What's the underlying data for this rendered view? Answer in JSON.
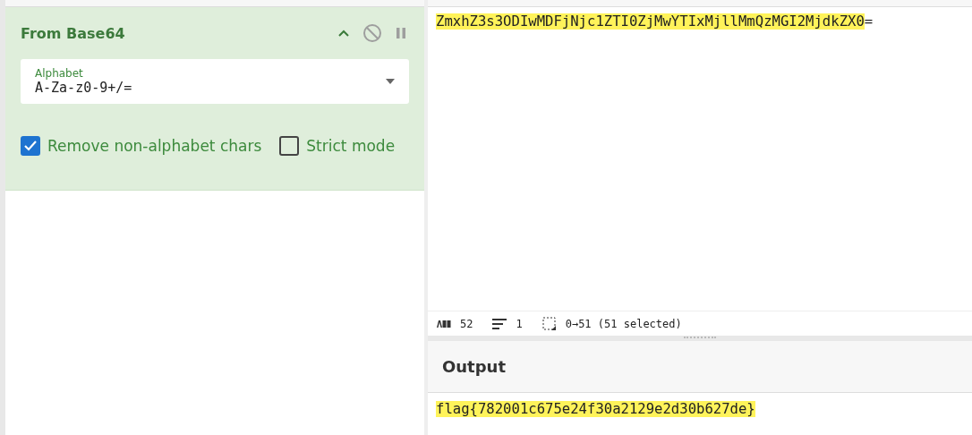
{
  "operation": {
    "title": "From Base64",
    "disabled": false,
    "paused": false,
    "alphabet": {
      "label": "Alphabet",
      "value": "A-Za-z0-9+/="
    },
    "options": [
      {
        "label": "Remove non-alphabet chars",
        "checked": true
      },
      {
        "label": "Strict mode",
        "checked": false
      }
    ]
  },
  "input": {
    "selected_text": "ZmxhZ3s3ODIwMDFjNjc1ZTI0ZjMwYTIxMjllMmQzMGI2MjdkZX0",
    "rest_text": "="
  },
  "status_bar": {
    "length": "52",
    "lines": "1",
    "selection": "0→51 (51 selected)"
  },
  "output": {
    "title": "Output",
    "text": "flag{782001c675e24f30a2129e2d30b627de}",
    "highlighted": true
  }
}
